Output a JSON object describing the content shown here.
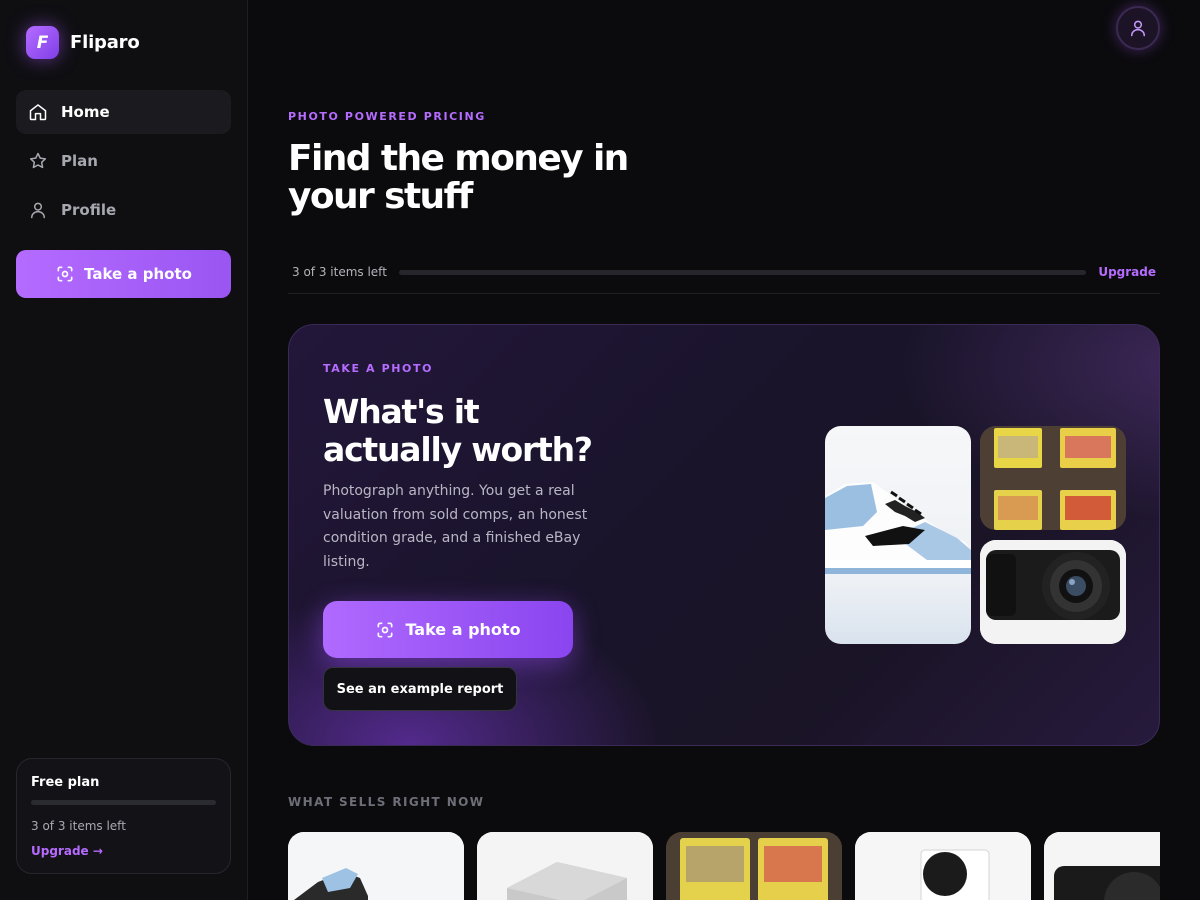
{
  "brand": {
    "name": "Fliparo",
    "logo_letter": "F"
  },
  "sidebar": {
    "items": [
      {
        "label": "Home",
        "icon": "home-icon",
        "active": true
      },
      {
        "label": "Plan",
        "icon": "star-icon",
        "active": false
      },
      {
        "label": "Profile",
        "icon": "user-icon",
        "active": false
      }
    ],
    "cta_label": "Take a photo",
    "plan_card": {
      "title": "Free plan",
      "count": "3 of 3 items left",
      "upgrade_label": "Upgrade →"
    }
  },
  "header": {
    "eyebrow": "PHOTO POWERED PRICING",
    "title": "Find the money in your stuff",
    "usage_label": "3 of 3 items left",
    "upgrade_label": "Upgrade"
  },
  "hero_card": {
    "eyebrow": "TAKE A PHOTO",
    "title": "What's it actually worth?",
    "description": "Photograph anything. You get a real valuation from sold comps, an honest condition grade, and a finished eBay listing.",
    "primary_cta": "Take a photo",
    "secondary_cta": "See an example report",
    "images": [
      "sneaker",
      "trading-cards",
      "camera"
    ]
  },
  "what_sells": {
    "label": "WHAT SELLS RIGHT NOW",
    "items": [
      "sneaker",
      "game-console",
      "trading-cards",
      "xbox-console",
      "camera"
    ]
  },
  "colors": {
    "accent": "#b56cff",
    "background": "#0b0b0d",
    "sidebar": "#0f0f12"
  }
}
